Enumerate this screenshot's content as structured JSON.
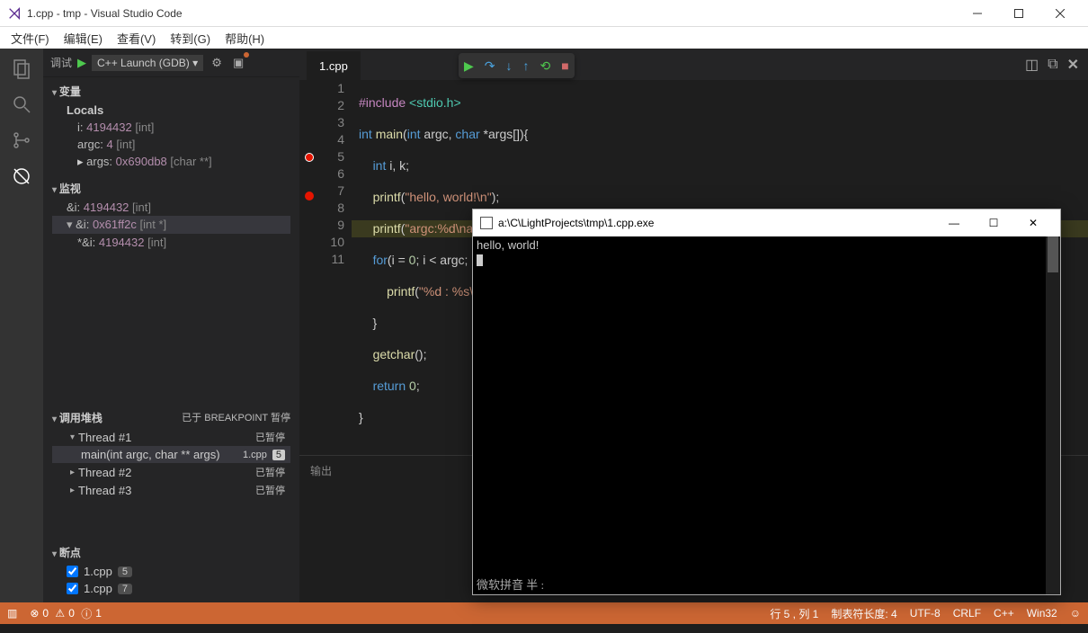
{
  "title": "1.cpp - tmp - Visual Studio Code",
  "menubar": [
    "文件(F)",
    "编辑(E)",
    "查看(V)",
    "转到(G)",
    "帮助(H)"
  ],
  "debug_dropdown_label": "调试",
  "debug_config": "C++ Launch (GDB) ▾",
  "sections": {
    "variables": "变量",
    "locals": "Locals",
    "watch": "监视",
    "callstack": "调用堆栈",
    "callstack_status": "已于 BREAKPOINT 暂停",
    "breakpoints": "断点"
  },
  "locals": [
    {
      "name": "i:",
      "value": "4194432",
      "type": "[int]",
      "expandable": false
    },
    {
      "name": "argc:",
      "value": "4",
      "type": "[int]",
      "expandable": false
    },
    {
      "name": "args:",
      "value": "0x690db8",
      "type": "[char **]",
      "expandable": true
    }
  ],
  "watch": [
    {
      "name": "&i:",
      "value": "4194432",
      "type": "[int]",
      "sel": false,
      "expandable": false
    },
    {
      "name": "&i:",
      "value": "0x61ff2c",
      "type": "[int *]",
      "sel": true,
      "expandable": true
    },
    {
      "name": "*&i:",
      "value": "4194432",
      "type": "[int]",
      "sel": false,
      "sub": true,
      "expandable": false
    }
  ],
  "threads": [
    {
      "name": "Thread #1",
      "status": "已暂停",
      "sel": false,
      "frames": [
        {
          "fn": "main(int argc, char ** args)",
          "file": "1.cpp",
          "line": "5",
          "sel": true
        }
      ]
    },
    {
      "name": "Thread #2",
      "status": "已暂停"
    },
    {
      "name": "Thread #3",
      "status": "已暂停"
    }
  ],
  "breakpoints": [
    {
      "file": "1.cpp",
      "line": "5"
    },
    {
      "file": "1.cpp",
      "line": "7"
    }
  ],
  "tab": "1.cpp",
  "output_label": "输出",
  "code_lines": 11,
  "console": {
    "title": "a:\\C\\LightProjects\\tmp\\1.cpp.exe",
    "output": "hello, world!",
    "ime": "微软拼音 半 :"
  },
  "status": {
    "errors": "0",
    "warnings": "0",
    "info": "1",
    "cursor": "行 5 , 列 1",
    "tabsize": "制表符长度: 4",
    "encoding": "UTF-8",
    "eol": "CRLF",
    "lang": "C++",
    "target": "Win32"
  }
}
